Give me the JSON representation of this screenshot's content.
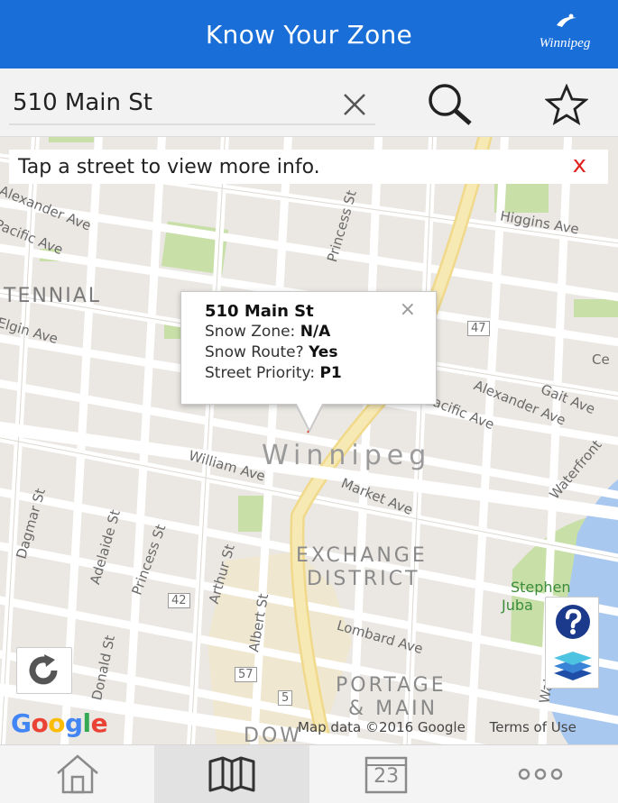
{
  "header": {
    "title": "Know Your Zone",
    "logo_text": "Winnipeg"
  },
  "search": {
    "value": "510 Main St",
    "placeholder": ""
  },
  "banner": {
    "text": "Tap a street to view more info.",
    "close": "x"
  },
  "popup": {
    "address": "510 Main St",
    "close": "×",
    "rows": [
      {
        "label": "Snow Zone: ",
        "value": "N/A"
      },
      {
        "label": "Snow Route? ",
        "value": "Yes"
      },
      {
        "label": "Street Priority: ",
        "value": "P1"
      }
    ]
  },
  "map_labels": {
    "tennial": "TENNIAL",
    "alexander_ave_w": "Alexander Ave",
    "pacific_ave_w": "Pacific Ave",
    "elgin_ave": "Elgin Ave",
    "princess_st_n": "Princess St",
    "higgins_ave": "Higgins Ave",
    "hwy47": "47",
    "ce": "Ce",
    "alexander_ave_e": "Alexander Ave",
    "gait_ave": "Gait Ave",
    "pacific_ave_e": "Pacific Ave",
    "winnipeg": "Winnipeg",
    "william_ave": "William Ave",
    "market_ave": "Market Ave",
    "waterfront": "Waterfront",
    "dagmar_st": "Dagmar St",
    "adelaide_st": "Adelaide St",
    "princess_st_s": "Princess St",
    "arthur_st": "Arthur St",
    "exchange": "EXCHANGE",
    "district": "DISTRICT",
    "stephen": "Stephen",
    "juba": "Juba",
    "hwy42": "42",
    "albert_st": "Albert St",
    "lombard_ave": "Lombard Ave",
    "waterfront_s": "Waterfront",
    "donald_st": "Donald St",
    "hwy57": "57",
    "portage": "PORTAGE",
    "and_main": "& MAIN",
    "hwy5": "5",
    "dow": "DOW"
  },
  "attribution": {
    "google": "Google",
    "map_data": "Map data ©2016 Google",
    "terms": "Terms of Use"
  },
  "nav": {
    "tabs": [
      {
        "id": "home",
        "icon": "home-icon"
      },
      {
        "id": "map",
        "icon": "map-icon",
        "active": true
      },
      {
        "id": "calendar",
        "icon": "calendar-icon",
        "day": "23"
      },
      {
        "id": "more",
        "icon": "more-icon"
      }
    ]
  },
  "colors": {
    "header": "#1a6ed8",
    "close_red": "#e0231f",
    "water": "#a9c8f0",
    "park": "#c8e0a8"
  }
}
